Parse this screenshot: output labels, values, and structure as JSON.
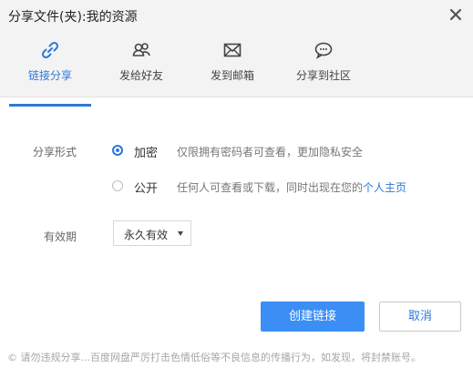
{
  "window": {
    "title": "分享文件(夹):我的资源"
  },
  "tabs": [
    {
      "label": "链接分享",
      "icon": "link-icon",
      "active": true
    },
    {
      "label": "发给好友",
      "icon": "friends-icon",
      "active": false
    },
    {
      "label": "发到邮箱",
      "icon": "mail-icon",
      "active": false
    },
    {
      "label": "分享到社区",
      "icon": "community-icon",
      "active": false
    }
  ],
  "share_form": {
    "label": "分享形式",
    "options": [
      {
        "label": "加密",
        "desc": "仅限拥有密码者可查看，更加隐私安全",
        "selected": true
      },
      {
        "label": "公开",
        "desc": "任何人可查看或下载，同时出现在您的",
        "link": "个人主页",
        "selected": false
      }
    ]
  },
  "validity": {
    "label": "有效期",
    "value": "永久有效"
  },
  "buttons": {
    "create": "创建链接",
    "cancel": "取消"
  },
  "footer": {
    "text": "© 请勿违规分享...百度网盘严厉打击色情低俗等不良信息的传播行为，如发现，将封禁账号。"
  },
  "colors": {
    "accent": "#2f78d6",
    "primary_button": "#3b8ef3",
    "header_bg": "#f3f3f3"
  }
}
